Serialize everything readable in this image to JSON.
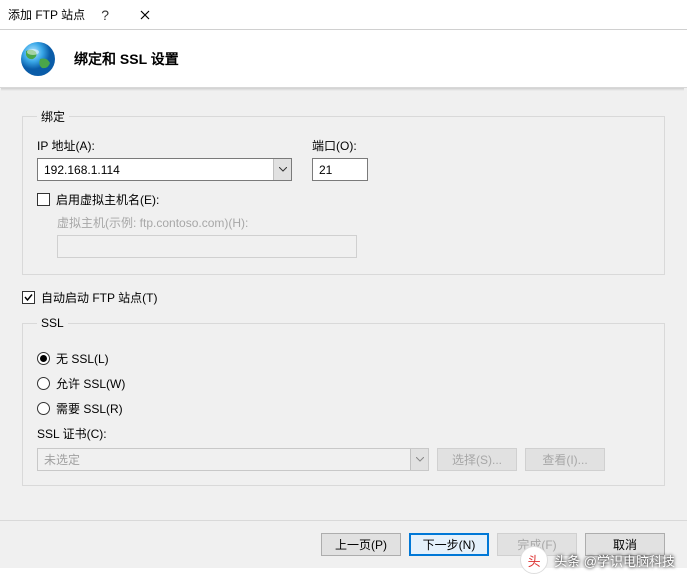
{
  "titlebar": {
    "title": "添加 FTP 站点"
  },
  "header": {
    "page_title": "绑定和 SSL 设置"
  },
  "binding": {
    "legend": "绑定",
    "ip_label": "IP 地址(A):",
    "ip_value": "192.168.1.114",
    "port_label": "端口(O):",
    "port_value": "21",
    "enable_vhost_label": "启用虚拟主机名(E):",
    "enable_vhost_checked": false,
    "vhost_label": "虚拟主机(示例: ftp.contoso.com)(H):",
    "vhost_value": ""
  },
  "autostart": {
    "label": "自动启动 FTP 站点(T)",
    "checked": true
  },
  "ssl": {
    "legend": "SSL",
    "options": {
      "none": "无 SSL(L)",
      "allow": "允许 SSL(W)",
      "require": "需要 SSL(R)"
    },
    "selected": "none",
    "cert_label": "SSL 证书(C):",
    "cert_value": "未选定",
    "select_btn": "选择(S)...",
    "view_btn": "查看(I)..."
  },
  "footer": {
    "prev": "上一页(P)",
    "next": "下一步(N)",
    "finish": "完成(F)",
    "cancel": "取消"
  },
  "watermark": {
    "avatar_text": "头",
    "text": "头条 @学识电脑科技"
  }
}
